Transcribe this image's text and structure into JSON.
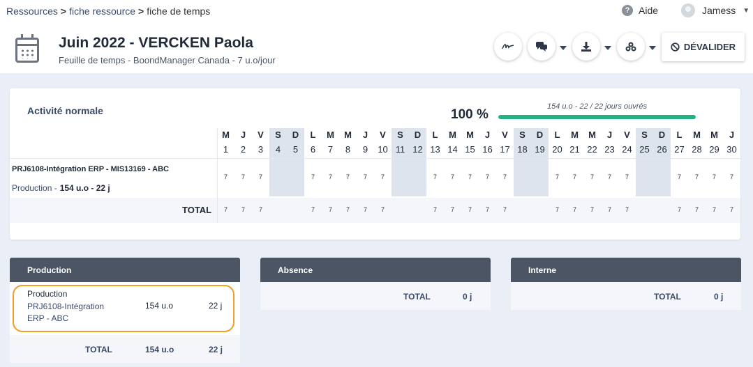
{
  "breadcrumb": {
    "item1": "Ressources",
    "item2": "fiche ressource",
    "item3": "fiche de temps"
  },
  "header": {
    "help_label": "Aide",
    "user_name": "Jamess"
  },
  "page": {
    "title": "Juin 2022 - VERCKEN Paola",
    "subtitle": "Feuille de temps - BoondManager Canada - 7 u.o/jour",
    "devalider_label": "DÉVALIDER"
  },
  "activity": {
    "title": "Activité normale",
    "percent": "100 %",
    "progress_label": "154 u.o - 22 / 22 jours ouvrés",
    "progress_fraction": 1.0,
    "days": [
      {
        "letter": "M",
        "num": "1",
        "weekend": false
      },
      {
        "letter": "J",
        "num": "2",
        "weekend": false
      },
      {
        "letter": "V",
        "num": "3",
        "weekend": false
      },
      {
        "letter": "S",
        "num": "4",
        "weekend": true
      },
      {
        "letter": "D",
        "num": "5",
        "weekend": true
      },
      {
        "letter": "L",
        "num": "6",
        "weekend": false
      },
      {
        "letter": "M",
        "num": "7",
        "weekend": false
      },
      {
        "letter": "M",
        "num": "8",
        "weekend": false
      },
      {
        "letter": "J",
        "num": "9",
        "weekend": false
      },
      {
        "letter": "V",
        "num": "10",
        "weekend": false
      },
      {
        "letter": "S",
        "num": "11",
        "weekend": true
      },
      {
        "letter": "D",
        "num": "12",
        "weekend": true
      },
      {
        "letter": "L",
        "num": "13",
        "weekend": false
      },
      {
        "letter": "M",
        "num": "14",
        "weekend": false
      },
      {
        "letter": "M",
        "num": "15",
        "weekend": false
      },
      {
        "letter": "J",
        "num": "16",
        "weekend": false
      },
      {
        "letter": "V",
        "num": "17",
        "weekend": false
      },
      {
        "letter": "S",
        "num": "18",
        "weekend": true
      },
      {
        "letter": "D",
        "num": "19",
        "weekend": true
      },
      {
        "letter": "L",
        "num": "20",
        "weekend": false
      },
      {
        "letter": "M",
        "num": "21",
        "weekend": false
      },
      {
        "letter": "M",
        "num": "22",
        "weekend": false
      },
      {
        "letter": "J",
        "num": "23",
        "weekend": false
      },
      {
        "letter": "V",
        "num": "24",
        "weekend": false
      },
      {
        "letter": "S",
        "num": "25",
        "weekend": true
      },
      {
        "letter": "D",
        "num": "26",
        "weekend": true
      },
      {
        "letter": "L",
        "num": "27",
        "weekend": false
      },
      {
        "letter": "M",
        "num": "28",
        "weekend": false
      },
      {
        "letter": "M",
        "num": "29",
        "weekend": false
      },
      {
        "letter": "J",
        "num": "30",
        "weekend": false
      }
    ],
    "project": {
      "name": "PRJ6108-Intégration ERP - MIS13169 - ABC",
      "sub_label": "Production -",
      "sub_value": "154 u.o - 22 j",
      "values": [
        "7",
        "7",
        "7",
        "",
        "",
        "7",
        "7",
        "7",
        "7",
        "7",
        "",
        "",
        "7",
        "7",
        "7",
        "7",
        "7",
        "",
        "",
        "7",
        "7",
        "7",
        "7",
        "7",
        "",
        "",
        "7",
        "7",
        "7",
        "7"
      ]
    },
    "total_label": "TOTAL",
    "totals": [
      "7",
      "7",
      "7",
      "",
      "",
      "7",
      "7",
      "7",
      "7",
      "7",
      "",
      "",
      "7",
      "7",
      "7",
      "7",
      "7",
      "",
      "",
      "7",
      "7",
      "7",
      "7",
      "7",
      "",
      "",
      "7",
      "7",
      "7",
      "7"
    ]
  },
  "panels": {
    "production": {
      "title": "Production",
      "item_category": "Production",
      "item_link_line1": "PRJ6108-Intégration",
      "item_link_line2": "ERP - ABC",
      "item_uo": "154 u.o",
      "item_days": "22 j",
      "total_label": "TOTAL",
      "total_uo": "154 u.o",
      "total_days": "22 j"
    },
    "absence": {
      "title": "Absence",
      "total_label": "TOTAL",
      "total_days": "0 j"
    },
    "interne": {
      "title": "Interne",
      "total_label": "TOTAL",
      "total_days": "0 j"
    }
  },
  "colors": {
    "accent_green": "#25b084",
    "panel_header": "#4b5563",
    "highlight_orange": "#f39c26",
    "weekend_shade": "#dde4ee"
  },
  "icons": [
    "help-icon",
    "avatar",
    "calendar-icon",
    "signature-icon",
    "chat-icon",
    "download-icon",
    "group-icon",
    "ban-icon"
  ]
}
